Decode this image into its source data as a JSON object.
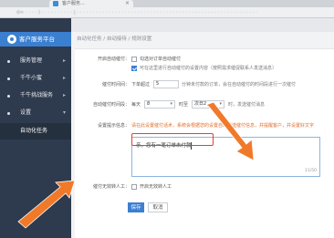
{
  "browser": {
    "tab_title": "客户服务...",
    "tab_close": "×",
    "address": "d=  ·  ·  ·  ·  )  ·  ·  ·  ·  ·  ·  ·  ·  ·  ·  |  ·  ·  ·  ·  ·  ·  ·  ·  ·  ·  ·  ·  ·  ·  ·  ·  ·  ·  ·  ·  ·  ·  ·  ·  ·  ·  ·  ·  ·  ·  ·  ·  ·  ·  ·  ·  ·  ·  ·  ·  ·  ·  ·  ·  ·  ·  ·  ·  ·  ·  ·  ·  ·  ·  ·  ·  ·"
  },
  "sidebar": {
    "brand": "客户服务平台",
    "items": [
      {
        "label": "服务管理",
        "caret": "▸"
      },
      {
        "label": "千牛小蜜",
        "caret": "▸"
      },
      {
        "label": "千牛挑战服务",
        "caret": "▸"
      },
      {
        "label": "设置",
        "caret": "▾"
      }
    ],
    "active_sub": "自动化任务"
  },
  "breadcrumb": "自动化任务 / 自动接待 / 规则设置",
  "form": {
    "enable_label": "开启自动催付：",
    "opt1": "勾选对订单自动催付",
    "opt2": "可在这里进行自动催付的设置内容（按照需求催促联系人发送消息）",
    "duration_label": "催付时间间：",
    "duration_prefix": "下单超过",
    "duration_value": "5",
    "duration_suffix": "分钟未付款的订单，会在自动催付的时间段进行一次催付",
    "time_label": "自动催付时间段：",
    "time_prefix": "每天",
    "time_from": "8",
    "time_mid": "时至",
    "time_to": "次日2",
    "time_suffix": "时，发送催付消息",
    "msg_label": "设置提示信息：",
    "msg_hint": "请在此设置催付话术，系统会根据您的设置自动发送催付信息，并提醒客户，并设置好文字",
    "msg_text": "亲，您有一笔订单未付款",
    "msg_count": "11/50",
    "transfer_label": "催付无效转人工：",
    "transfer_opt": "开启无效转人工",
    "save": "保存",
    "cancel": "取消"
  },
  "colors": {
    "accent": "#3b7fd1",
    "sidebar": "#2e3a4d",
    "guide": "#e5402f",
    "arrow": "#f07a2a"
  }
}
